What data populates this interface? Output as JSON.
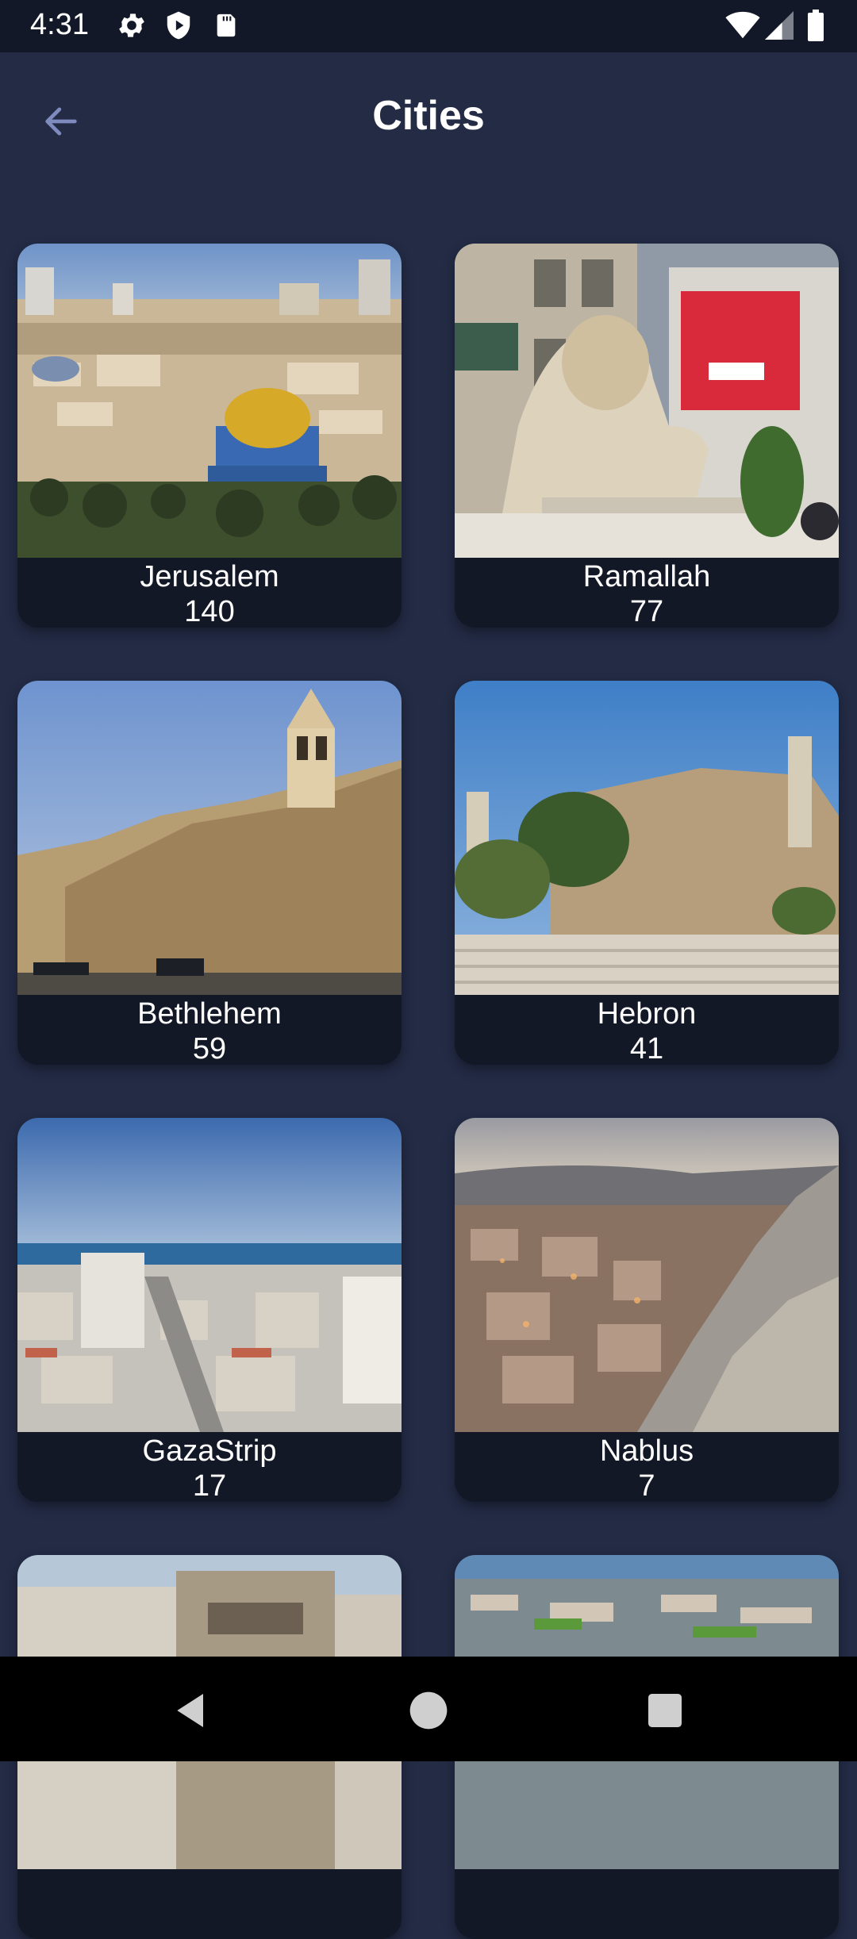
{
  "status_bar": {
    "time": "4:31",
    "icons_left": [
      "gear-icon",
      "shield-play-icon",
      "sd-card-icon"
    ],
    "icons_right": [
      "wifi-icon",
      "signal-icon",
      "battery-icon"
    ]
  },
  "app_bar": {
    "title": "Cities",
    "back_icon": "arrow-left-icon"
  },
  "cities": [
    {
      "name": "Jerusalem",
      "count": "140"
    },
    {
      "name": "Ramallah",
      "count": "77"
    },
    {
      "name": "Bethlehem",
      "count": "59"
    },
    {
      "name": "Hebron",
      "count": "41"
    },
    {
      "name": "GazaStrip",
      "count": "17"
    },
    {
      "name": "Nablus",
      "count": "7"
    }
  ],
  "nav_bar": {
    "icons": [
      "back-triangle-icon",
      "home-circle-icon",
      "recents-square-icon"
    ]
  },
  "colors": {
    "background": "#232b45",
    "card": "#131827",
    "status_bar": "#131828",
    "nav_bar": "#000000"
  }
}
